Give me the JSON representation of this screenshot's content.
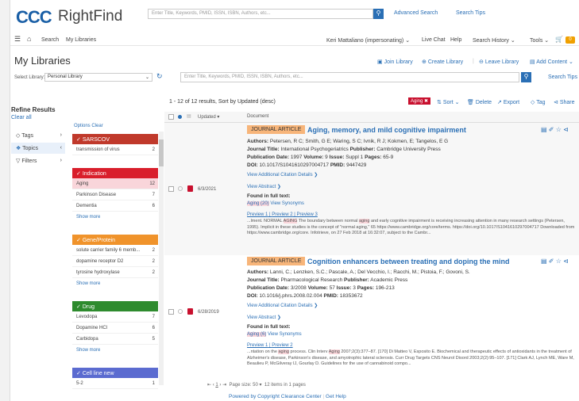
{
  "header": {
    "logo": "CCC",
    "app_name": "RightFind",
    "search_placeholder": "Enter Title, Keywords, PMID, ISSN, ISBN, Authors, etc...",
    "advanced_search": "Advanced Search",
    "search_tips": "Search Tips"
  },
  "nav": {
    "search": "Search",
    "my_libraries": "My Libraries",
    "user": "Keri Mattaliano (impersonating)",
    "live_chat": "Live Chat",
    "help": "Help",
    "search_history": "Search History",
    "tools": "Tools",
    "cart_count": "0"
  },
  "libraries": {
    "title": "My Libraries",
    "join": "Join Library",
    "create": "Create Library",
    "leave": "Leave Library",
    "add_content": "Add Content",
    "select_label": "Select Library:",
    "selected": "Personal Library",
    "search_placeholder": "Enter Title, Keywords, PMID, ISSN, ISBN, Authors, etc...",
    "search_tips": "Search Tips"
  },
  "refine": {
    "title": "Refine Results",
    "clear_all": "Clear all",
    "options": "Options",
    "clear": "Clear",
    "nav": [
      "Tags",
      "Topics",
      "Filters"
    ],
    "facets": [
      {
        "name": "SARSCOV",
        "color": "#c0392b",
        "rows": [
          {
            "label": "transmission of virus",
            "count": "2"
          }
        ],
        "show_more": ""
      },
      {
        "name": "Indication",
        "color": "#d91e2b",
        "rows": [
          {
            "label": "Aging",
            "count": "12"
          },
          {
            "label": "Parkinson Disease",
            "count": "7"
          },
          {
            "label": "Dementia",
            "count": "6"
          }
        ],
        "show_more": "Show more"
      },
      {
        "name": "Gene/Protein",
        "color": "#f0932b",
        "rows": [
          {
            "label": "solute carrier family 6 memb...",
            "count": "2"
          },
          {
            "label": "dopamine receptor D2",
            "count": "2"
          },
          {
            "label": "tyrosine hydroxylase",
            "count": "2"
          }
        ],
        "show_more": "Show more"
      },
      {
        "name": "Drug",
        "color": "#2e8b2e",
        "rows": [
          {
            "label": "Levodopa",
            "count": "7"
          },
          {
            "label": "Dopamine HCl",
            "count": "6"
          },
          {
            "label": "Carbidopa",
            "count": "5"
          }
        ],
        "show_more": "Show more"
      },
      {
        "name": "Cell line new",
        "color": "#5b6bd0",
        "rows": [
          {
            "label": "5-2",
            "count": "1"
          }
        ],
        "show_more": ""
      }
    ]
  },
  "results": {
    "count_text": "1 - 12 of 12 results, Sort by Updated (desc)",
    "active_tag": "Aging",
    "sort": "Sort",
    "delete": "Delete",
    "export": "Export",
    "tag": "Tag",
    "share": "Share",
    "col_updated": "Updated",
    "col_document": "Document",
    "items": [
      {
        "type": "JOURNAL ARTICLE",
        "title": "Aging, memory, and mild cognitive impairment",
        "date": "6/3/2021",
        "authors": "Petersen, R C; Smith, G E; Waring, S C; Ivnik, R J; Kokmen, E; Tangelos, E G",
        "journal": "International Psychogeriatrics",
        "publisher": "Cambridge University Press",
        "pub_date": "1997",
        "volume": "9",
        "issue": "Suppl 1",
        "pages": "65-9",
        "doi": "10.1017/S1041610297004717",
        "pmid": "9447429",
        "fulltext": "Aging (20)",
        "previews": [
          "Preview 1",
          "Preview 2",
          "Preview 3"
        ],
        "snippet_pre": "...lment. NORMAL ",
        "snippet_hl": "AGING",
        "snippet_mid": " The boundary between normal ",
        "snippet_hl2": "aging",
        "snippet_post": " and early cognitive impairment is receiving increasing attention in many research settings (Petersen, 1995). Implicit in these studies is the concept of \"normal aging,\" 65 https://www.cambridge.org/core/terms. https://doi.org/10.1017/S1041610297004717 Downloaded from https://www.cambridge.org/core. Infotrieve, on 27 Feb 2018 at 16:32:07, subject to the Cambr..."
      },
      {
        "type": "JOURNAL ARTICLE",
        "title": "Cognition enhancers between treating and doping the mind",
        "date": "6/28/2019",
        "authors": "Lanni, C.; Lenzken, S.C.; Pascale, A.; Del Vecchio, I.; Racchi, M.; Pistoia, F.; Govoni, S.",
        "journal": "Pharmacological Research",
        "publisher": "Academic Press",
        "pub_date": "3/2008",
        "volume": "57",
        "issue": "3",
        "pages": "196-213",
        "doi": "10.1016/j.phrs.2008.02.004",
        "pmid": "18353672",
        "fulltext": "Aging (6)",
        "previews": [
          "Preview 1",
          "Preview 2"
        ],
        "snippet_pre": "...ntation on the ",
        "snippet_hl": "aging",
        "snippet_mid": " process. Clin Interv ",
        "snippet_hl2": "Aging",
        "snippet_post": " 2007;2(3):377–87. [170] Di Matteo V, Esposito E. Biochemical and therapeutic effects of antioxidants in the treatment of Alzheimer's disease, Parkinson's disease, and amyotrophic lateral sclerosis. Curr Drug Targets CNS Neurol Disord 2003;2(2):95–107. [171] Clark AJ, Lynch ME, Ware M, Beaulieu P, McGilveray IJ, Gourlay D. Guidelines for the use of cannabinoid compo..."
      }
    ],
    "labels": {
      "authors": "Authors:",
      "journal": "Journal Title:",
      "publisher": "Publisher:",
      "pub_date": "Publication Date:",
      "volume": "Volume:",
      "issue": "Issue:",
      "pages": "Pages:",
      "doi": "DOI:",
      "pmid": "PMID:",
      "view_citation": "View Additional Citation Details",
      "view_abstract": "View Abstract",
      "found_fulltext": "Found in full text:",
      "view_synonyms": "View Synonyms"
    }
  },
  "pager": {
    "page": "1",
    "page_size_label": "Page size:",
    "page_size": "50",
    "summary": "12 items in 1 pages"
  },
  "footer": {
    "powered": "Powered by Copyright Clearance Center",
    "help": "Get Help"
  }
}
